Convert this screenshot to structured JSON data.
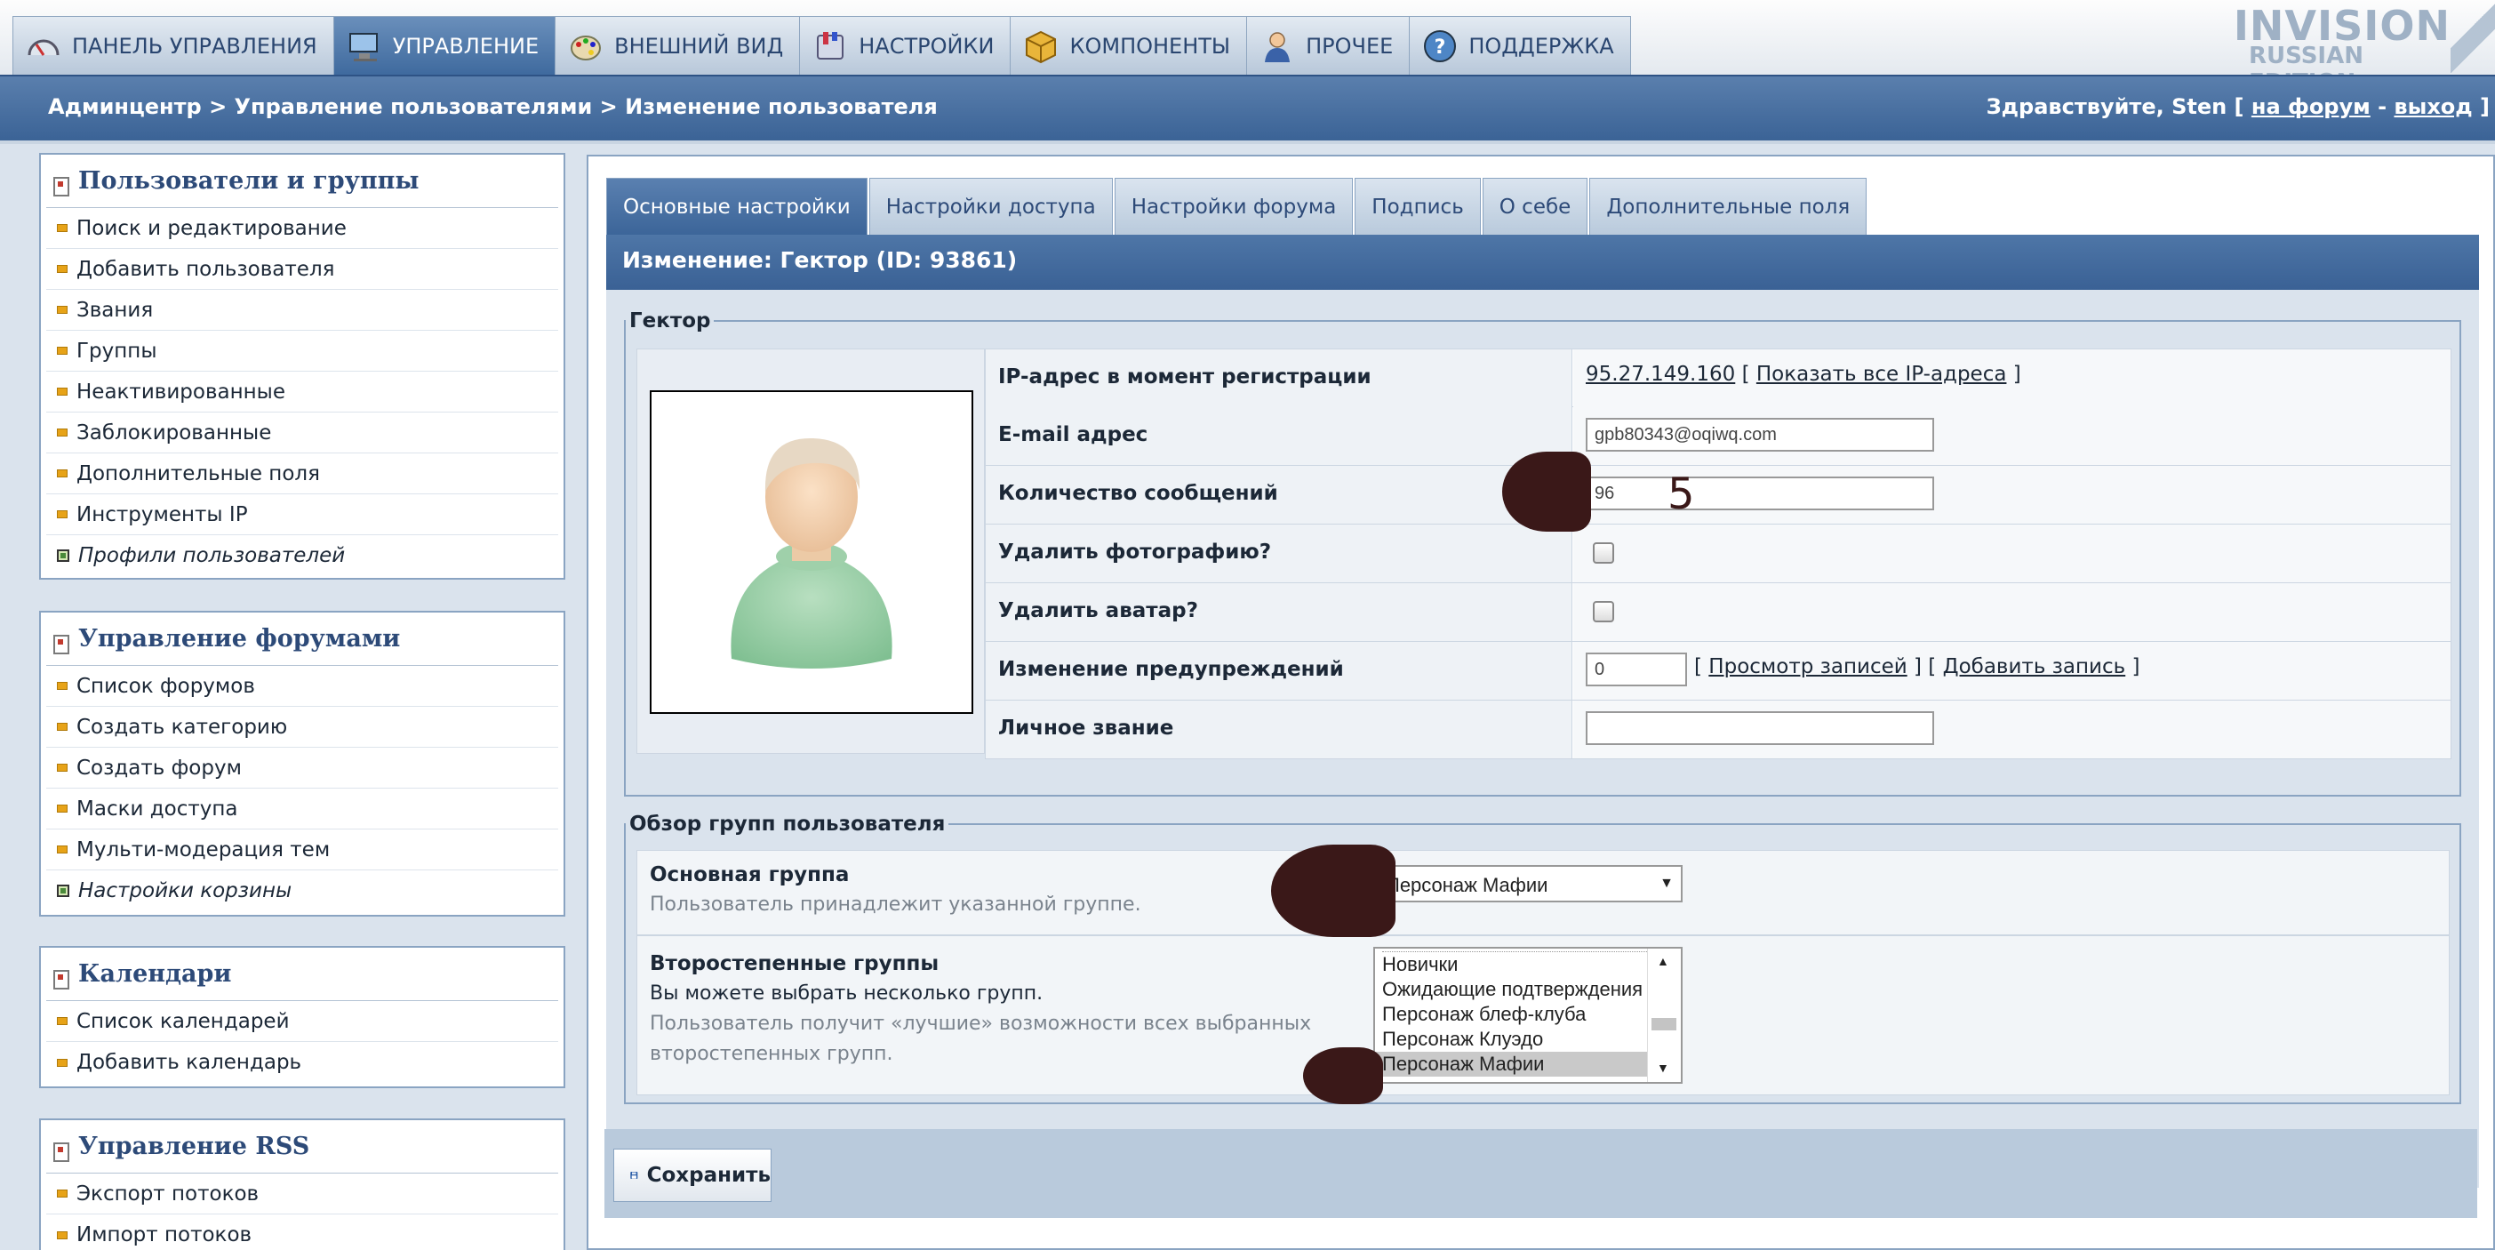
{
  "top_tabs": [
    {
      "label": "ПАНЕЛЬ УПРАВЛЕНИЯ",
      "icon": "gauge-icon"
    },
    {
      "label": "УПРАВЛЕНИЕ",
      "icon": "computer-icon",
      "active": true
    },
    {
      "label": "ВНЕШНИЙ ВИД",
      "icon": "palette-icon"
    },
    {
      "label": "НАСТРОЙКИ",
      "icon": "settings-icon"
    },
    {
      "label": "КОМПОНЕНТЫ",
      "icon": "box-icon"
    },
    {
      "label": "ПРОЧЕЕ",
      "icon": "user-icon"
    },
    {
      "label": "ПОДДЕРЖКА",
      "icon": "help-icon"
    }
  ],
  "logo": {
    "line1": "INVISION",
    "line2": "RUSSIAN EDITION"
  },
  "breadcrumb": "Админцентр > Управление пользователями > Изменение пользователя",
  "greeting": {
    "prefix": "Здравствуйте, Sten [ ",
    "forum_link": "на форум",
    "sep": " - ",
    "logout_link": "выход",
    "suffix": " ]"
  },
  "sidebar": [
    {
      "title": "Пользователи и группы",
      "items": [
        {
          "label": "Поиск и редактирование"
        },
        {
          "label": "Добавить пользователя"
        },
        {
          "label": "Звания"
        },
        {
          "label": "Группы"
        },
        {
          "label": "Неактивированные"
        },
        {
          "label": "Заблокированные"
        },
        {
          "label": "Дополнительные поля"
        },
        {
          "label": "Инструменты IP"
        },
        {
          "label": "Профили пользователей",
          "special": true
        }
      ]
    },
    {
      "title": "Управление форумами",
      "items": [
        {
          "label": "Список форумов"
        },
        {
          "label": "Создать категорию"
        },
        {
          "label": "Создать форум"
        },
        {
          "label": "Маски доступа"
        },
        {
          "label": "Мульти-модерация тем"
        },
        {
          "label": "Настройки корзины",
          "special": true
        }
      ]
    },
    {
      "title": "Календари",
      "items": [
        {
          "label": "Список календарей"
        },
        {
          "label": "Добавить календарь"
        }
      ]
    },
    {
      "title": "Управление RSS",
      "items": [
        {
          "label": "Экспорт потоков"
        },
        {
          "label": "Импорт потоков"
        }
      ]
    }
  ],
  "form_tabs": [
    "Основные настройки",
    "Настройки доступа",
    "Настройки форума",
    "Подпись",
    "О себе",
    "Дополнительные поля"
  ],
  "form_title": "Изменение: Гектор (ID: 93861)",
  "user_fieldset": "Гектор",
  "fields": {
    "ip_label": "IP-адрес в момент регистрации",
    "ip_value": "95.27.149.160",
    "ip_all": "Показать все IP-адреса",
    "email_label": "E-mail адрес",
    "email_value": "gpb80343@oqiwq.com",
    "posts_label": "Количество сообщений",
    "posts_value": "96",
    "posts_overlay": "5",
    "delphoto_label": "Удалить фотографию?",
    "delavatar_label": "Удалить аватар?",
    "warn_label": "Изменение предупреждений",
    "warn_value": "0",
    "warn_view": "Просмотр записей",
    "warn_add": "Добавить запись",
    "title_label": "Личное звание",
    "title_value": ""
  },
  "groups": {
    "legend": "Обзор групп пользователя",
    "primary_label": "Основная группа",
    "primary_desc": "Пользователь принадлежит указанной группе.",
    "primary_value": "Персонаж Мафии",
    "secondary_label": "Второстепенные группы",
    "secondary_desc1": "Вы можете выбрать несколько групп.",
    "secondary_desc2": "Пользователь получит «лучшие» возможности всех выбранных",
    "secondary_desc3": "второстепенных групп.",
    "secondary_options": [
      "Новички",
      "Ожидающие подтверждения",
      "Персонаж блеф-клуба",
      "Персонаж Клуэдо",
      "Персонаж Мафии"
    ],
    "secondary_selected": "Персонаж Мафии"
  },
  "save_label": "Сохранить"
}
